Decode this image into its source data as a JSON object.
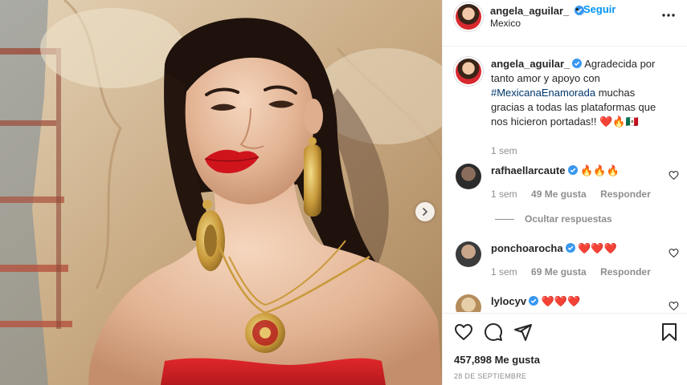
{
  "post": {
    "image_alt": "Retrato de mujer con vestido rojo, labios rojos y aretes dorados"
  },
  "header": {
    "username": "angela_aguilar_",
    "separator": "•",
    "follow_label": "Seguir",
    "location": "Mexico"
  },
  "caption": {
    "username": "angela_aguilar_",
    "text_before": "Agradecida por tanto amor y apoyo con ",
    "hashtag": "#MexicanaEnamorada",
    "text_after": " muchas gracias a todas las plataformas que nos hicieron portadas!! ❤️🔥🇲🇽",
    "time": "1 sem"
  },
  "comments": [
    {
      "username": "rafhaellarcaute",
      "text": "🔥🔥🔥",
      "time": "1 sem",
      "likes": "49 Me gusta",
      "reply_label": "Responder",
      "replies_toggle": "Ocultar respuestas"
    },
    {
      "username": "ponchoarocha",
      "text": "❤️❤️❤️",
      "time": "1 sem",
      "likes": "69 Me gusta",
      "reply_label": "Responder"
    },
    {
      "username": "lylocyv",
      "text": "❤️❤️❤️"
    }
  ],
  "actions": {
    "like_icon": "heart-icon",
    "comment_icon": "comment-icon",
    "share_icon": "share-icon",
    "save_icon": "bookmark-icon"
  },
  "likes_count": "457,898 Me gusta",
  "date": "28 DE SEPTIEMBRE",
  "colors": {
    "accent": "#0095f6",
    "verified": "#3897f0",
    "hashtag": "#00376b",
    "muted": "#8e8e8e",
    "dress_red": "#d8292f"
  }
}
